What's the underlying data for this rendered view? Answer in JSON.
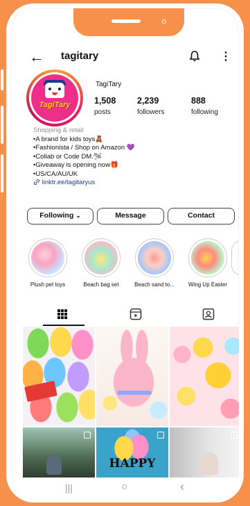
{
  "profile": {
    "username": "tagitary",
    "display_name": "TagiTary",
    "avatar_logo_text": "TagiTary",
    "stats": [
      {
        "value": "1,508",
        "label": "posts"
      },
      {
        "value": "2,239",
        "label": "followers"
      },
      {
        "value": "888",
        "label": "following"
      }
    ],
    "bio": {
      "category": "Shopping & retail",
      "lines": [
        "•A brand for kids toys🧸",
        "•Fashionista / Shop on Amazon 💜",
        "•Collab or Code DM.🛩",
        "•Giveaway is opening now🎁",
        "•US/CA/AU/UK"
      ],
      "link": "linktr.ee/tagitaryus"
    }
  },
  "actions": {
    "following_label": "Following",
    "message_label": "Message",
    "contact_label": "Contact"
  },
  "highlights": [
    {
      "label": "Plush pet toys"
    },
    {
      "label": "Beach bag set"
    },
    {
      "label": "Beach sand to..."
    },
    {
      "label": "Wing Up Easter"
    }
  ],
  "tabs": [
    "grid-icon",
    "reels-icon",
    "tagged-icon"
  ],
  "grid_posts": {
    "happy_text": "HAPPY"
  },
  "icons": {
    "back": "←",
    "more": "⋮",
    "nav_recent": "|||",
    "nav_home": "○",
    "nav_back": "‹"
  },
  "colors": {
    "frame": "#f6904a",
    "link": "#1a3d8f",
    "avatar_bg": "#ee2f8a"
  }
}
